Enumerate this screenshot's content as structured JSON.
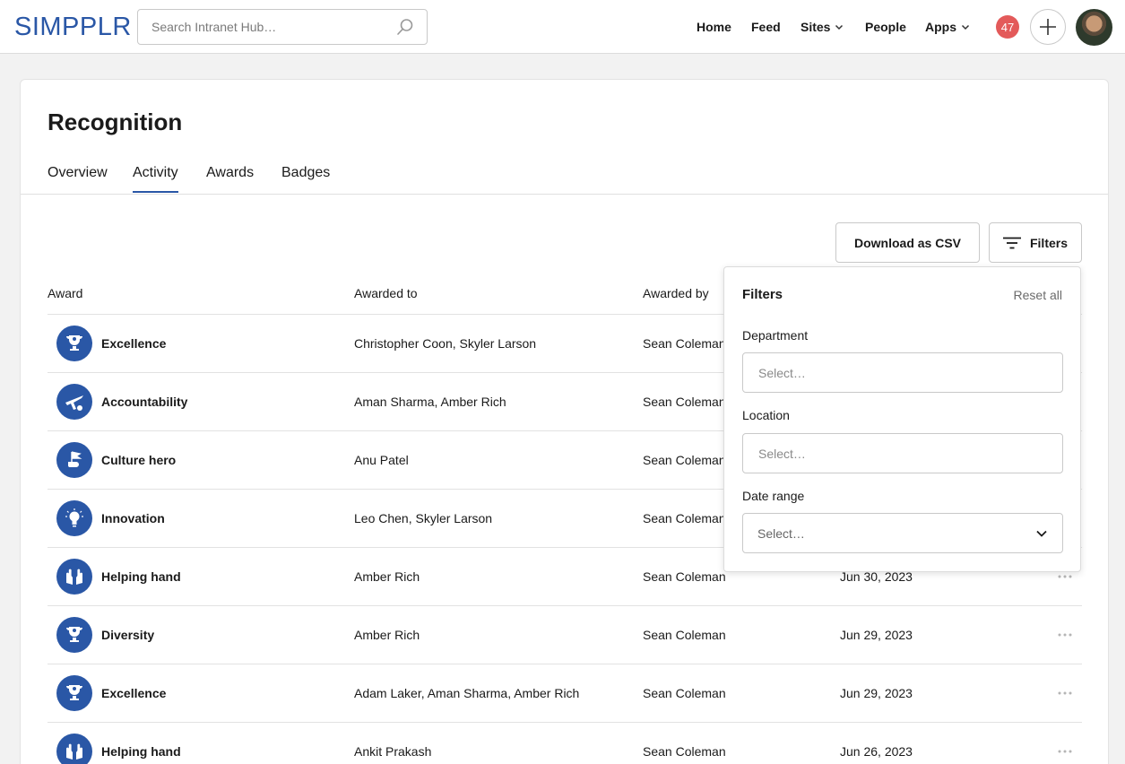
{
  "header": {
    "logo_text": "SIMPPLR",
    "search_placeholder": "Search Intranet Hub…",
    "nav": [
      {
        "label": "Home"
      },
      {
        "label": "Feed"
      },
      {
        "label": "Sites"
      },
      {
        "label": "People"
      },
      {
        "label": "Apps"
      }
    ],
    "notification_count": "47",
    "accent_color": "#2a57a6",
    "badge_color": "#e35a5a"
  },
  "page": {
    "title": "Recognition",
    "tabs": [
      {
        "label": "Overview"
      },
      {
        "label": "Activity",
        "active": true
      },
      {
        "label": "Awards"
      },
      {
        "label": "Badges"
      }
    ],
    "download_label": "Download as CSV",
    "filters_label": "Filters"
  },
  "table": {
    "columns": [
      "Award",
      "Awarded to",
      "Awarded by"
    ],
    "rows": [
      {
        "award": "Excellence",
        "icon": "trophy-icon",
        "to": "Christopher Coon, Skyler Larson",
        "by": "Sean Coleman",
        "date": ""
      },
      {
        "award": "Accountability",
        "icon": "airplane-icon",
        "to": "Aman Sharma, Amber Rich",
        "by": "Sean Coleman",
        "date": ""
      },
      {
        "award": "Culture hero",
        "icon": "flag-hand-icon",
        "to": "Anu Patel",
        "by": "Sean Coleman",
        "date": ""
      },
      {
        "award": "Innovation",
        "icon": "lightbulb-icon",
        "to": "Leo Chen, Skyler Larson",
        "by": "Sean Coleman",
        "date": ""
      },
      {
        "award": "Helping hand",
        "icon": "hands-icon",
        "to": "Amber Rich",
        "by": "Sean Coleman",
        "date": "Jun 30, 2023"
      },
      {
        "award": "Diversity",
        "icon": "trophy-icon",
        "to": "Amber Rich",
        "by": "Sean Coleman",
        "date": "Jun 29, 2023"
      },
      {
        "award": "Excellence",
        "icon": "trophy-icon",
        "to": "Adam Laker, Aman Sharma, Amber Rich",
        "by": "Sean Coleman",
        "date": "Jun 29, 2023"
      },
      {
        "award": "Helping hand",
        "icon": "hands-icon",
        "to": "Ankit Prakash",
        "by": "Sean Coleman",
        "date": "Jun 26, 2023"
      }
    ]
  },
  "filters_panel": {
    "title": "Filters",
    "reset_label": "Reset all",
    "department_label": "Department",
    "department_placeholder": "Select…",
    "location_label": "Location",
    "location_placeholder": "Select…",
    "date_range_label": "Date range",
    "date_range_value": "Select…"
  }
}
